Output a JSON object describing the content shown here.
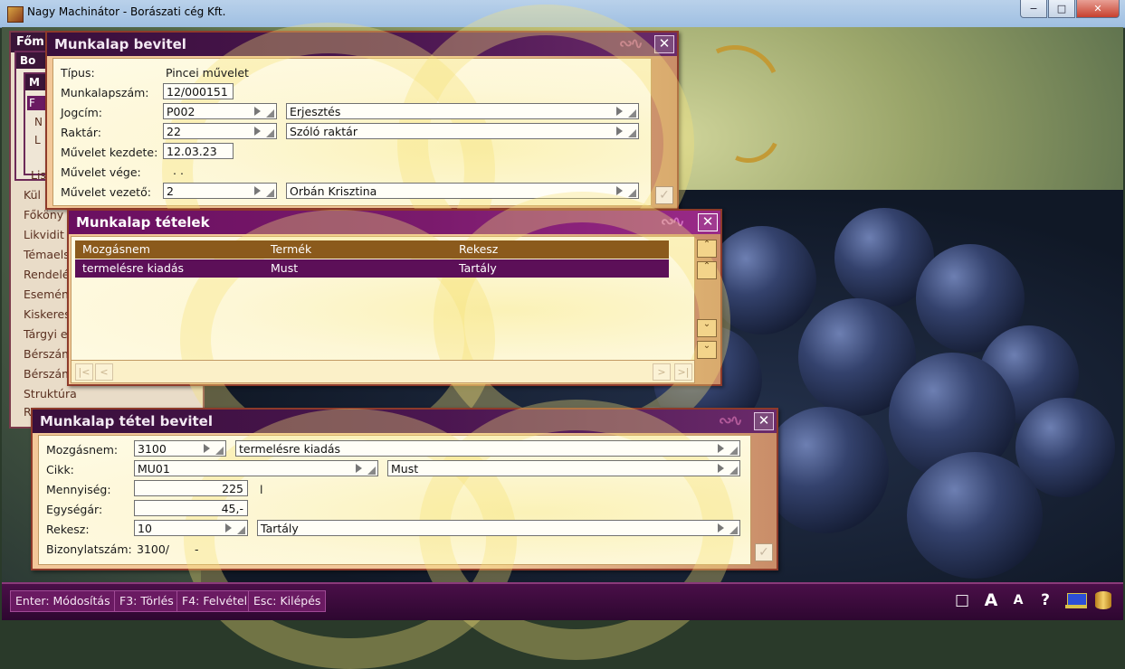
{
  "window": {
    "title": "Nagy Machinátor - Borászati cég Kft.",
    "controls": [
      "−",
      "□",
      "✕"
    ]
  },
  "background_menu": {
    "title": "Főm",
    "sub1_title": "Bo",
    "sub2_title": "M",
    "items": [
      "F",
      "N",
      "L",
      "Lis",
      "Kül",
      "Főköny",
      "Likvidit",
      "Témaels",
      "Rendelé",
      "Esemén",
      "Kiskeres",
      "Tárgyi e",
      "Bérszám",
      "Bérszám",
      "Struktúra",
      "R"
    ]
  },
  "munkalap_bevitel": {
    "title": "Munkalap bevitel",
    "logo": "∾∿",
    "close": "✕",
    "fields": {
      "tipus": {
        "label": "Típus:",
        "value": "Pincei művelet"
      },
      "szam": {
        "label": "Munkalapszám:",
        "value": "12/000151"
      },
      "jogcim": {
        "label": "Jogcím:",
        "code": "P002",
        "name": "Erjesztés"
      },
      "raktar": {
        "label": "Raktár:",
        "code": "22",
        "name": "Szóló raktár"
      },
      "kezdete": {
        "label": "Művelet kezdete:",
        "value": "12.03.23"
      },
      "vege": {
        "label": "Művelet vége:",
        "value": ". ."
      },
      "vezeto": {
        "label": "Művelet vezető:",
        "code": "2",
        "name": "Orbán Krisztina"
      }
    },
    "ok": "✓"
  },
  "munkalap_tetelek": {
    "title": "Munkalap tételek",
    "logo": "∾∿",
    "close": "✕",
    "columns": [
      "Mozgásnem",
      "Termék",
      "Rekesz"
    ],
    "rows": [
      [
        "termelésre kiadás",
        "Must",
        "Tartály"
      ]
    ],
    "scroll": {
      "first": "⌃",
      "prev": "⌃",
      "next": "⌄",
      "last": "⌄"
    },
    "nav": {
      "first": "|<",
      "prev": "<",
      "next": ">",
      "last": ">|"
    }
  },
  "tetel_bevitel": {
    "title": "Munkalap tétel bevitel",
    "logo": "∾∿",
    "close": "✕",
    "fields": {
      "mozgasnem": {
        "label": "Mozgásnem:",
        "code": "3100",
        "name": "termelésre kiadás"
      },
      "cikk": {
        "label": "Cikk:",
        "code": "MU01",
        "name": "Must"
      },
      "mennyiseg": {
        "label": "Mennyiség:",
        "value": "225",
        "unit": "l"
      },
      "egysegar": {
        "label": "Egységár:",
        "value": "45,-"
      },
      "rekesz": {
        "label": "Rekesz:",
        "code": "10",
        "name": "Tartály"
      },
      "bizonylat": {
        "label": "Bizonylatszám:",
        "value": "3100/",
        "value2": "-"
      }
    },
    "ok": "✓"
  },
  "bottom_bar": {
    "keys": [
      "Enter: Módosítás",
      "F3: Törlés",
      "F4: Felvétel",
      "Esc: Kilépés"
    ],
    "tools": [
      "□",
      "A",
      "A",
      "?"
    ]
  }
}
